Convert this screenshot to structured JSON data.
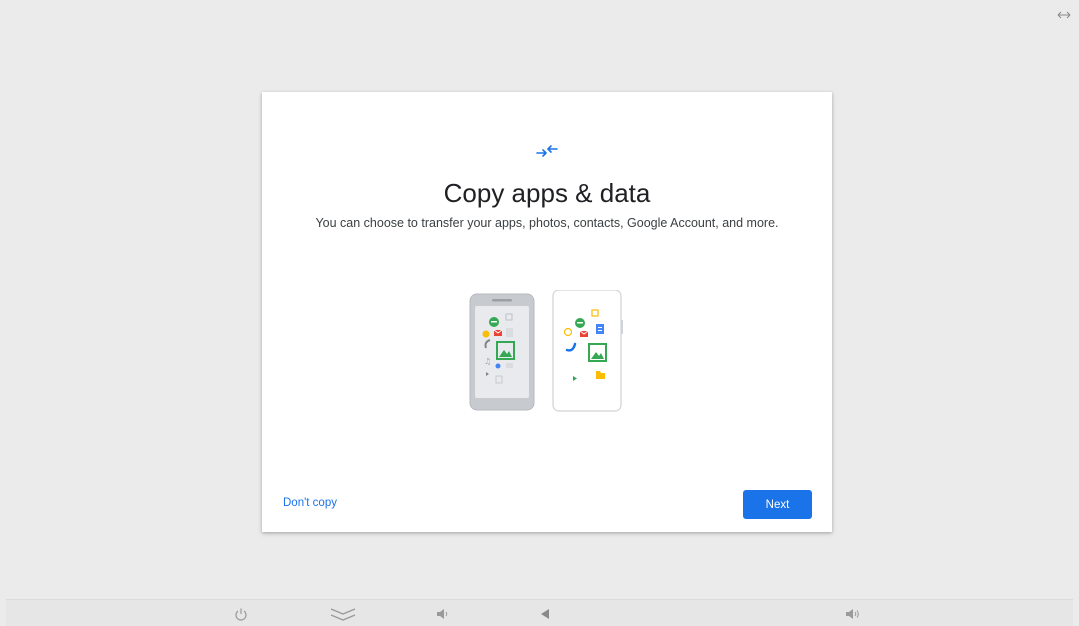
{
  "setup": {
    "title": "Copy apps & data",
    "subtitle": "You can choose to transfer your apps, photos, contacts, Google Account, and more.",
    "dont_copy_label": "Don't copy",
    "next_label": "Next"
  },
  "icons": {
    "corner": "resize-arrows-icon",
    "transfer": "transfer-arrows-icon",
    "illustration": "phones-transfer-illustration"
  },
  "navbar": {
    "items": [
      "power-icon",
      "chevron-down-icon",
      "volume-down-icon",
      "back-icon",
      "volume-up-icon"
    ]
  },
  "colors": {
    "accent": "#1a73e8",
    "background": "#ebebeb",
    "card": "#ffffff"
  }
}
